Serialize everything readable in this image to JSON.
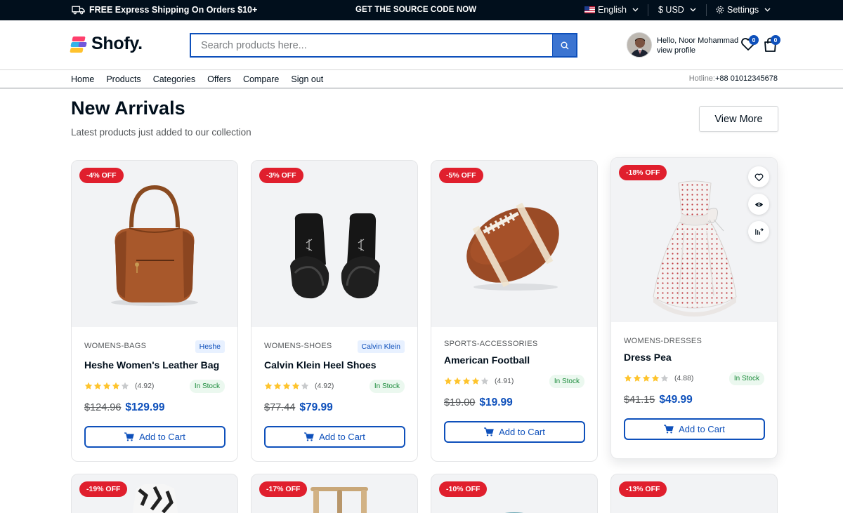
{
  "topbar": {
    "shipping": "FREE Express Shipping On Orders $10+",
    "source": "GET THE SOURCE CODE NOW",
    "language": "English",
    "currency": "$ USD",
    "settings": "Settings"
  },
  "header": {
    "logo": "Shofy.",
    "search_placeholder": "Search products here...",
    "user_greeting": "Hello, Noor Mohammad",
    "user_link": "view profile",
    "wishlist_count": "0",
    "cart_count": "0"
  },
  "nav": {
    "links": [
      "Home",
      "Products",
      "Categories",
      "Offers",
      "Compare",
      "Sign out"
    ],
    "hotline_label": "Hotline:",
    "hotline_value": "+88 01012345678"
  },
  "section": {
    "title": "New Arrivals",
    "subtitle": "Latest products just added to our collection",
    "view_more": "View More"
  },
  "products": [
    {
      "discount": "-4% OFF",
      "category": "WOMENS-BAGS",
      "brand": "Heshe",
      "name": "Heshe Women's Leather Bag",
      "stars": 4,
      "rating": "(4.92)",
      "stock": "In Stock",
      "old_price": "$124.96",
      "price": "$129.99",
      "cta": "Add to Cart"
    },
    {
      "discount": "-3% OFF",
      "category": "WOMENS-SHOES",
      "brand": "Calvin Klein",
      "name": "Calvin Klein Heel Shoes",
      "stars": 4,
      "rating": "(4.92)",
      "stock": "In Stock",
      "old_price": "$77.44",
      "price": "$79.99",
      "cta": "Add to Cart"
    },
    {
      "discount": "-5% OFF",
      "category": "SPORTS-ACCESSORIES",
      "brand": "",
      "name": "American Football",
      "stars": 4,
      "rating": "(4.91)",
      "stock": "In Stock",
      "old_price": "$19.00",
      "price": "$19.99",
      "cta": "Add to Cart"
    },
    {
      "discount": "-18% OFF",
      "category": "WOMENS-DRESSES",
      "brand": "",
      "name": "Dress Pea",
      "stars": 4,
      "rating": "(4.88)",
      "stock": "In Stock",
      "old_price": "$41.15",
      "price": "$49.99",
      "cta": "Add to Cart"
    }
  ],
  "products_row2": [
    {
      "discount": "-19% OFF"
    },
    {
      "discount": "-17% OFF"
    },
    {
      "discount": "-10% OFF"
    },
    {
      "discount": "-13% OFF"
    }
  ],
  "colors": {
    "accent": "#0e50bb",
    "sale": "#e01f2d",
    "dark": "#010f1c",
    "star": "#fec42d"
  }
}
